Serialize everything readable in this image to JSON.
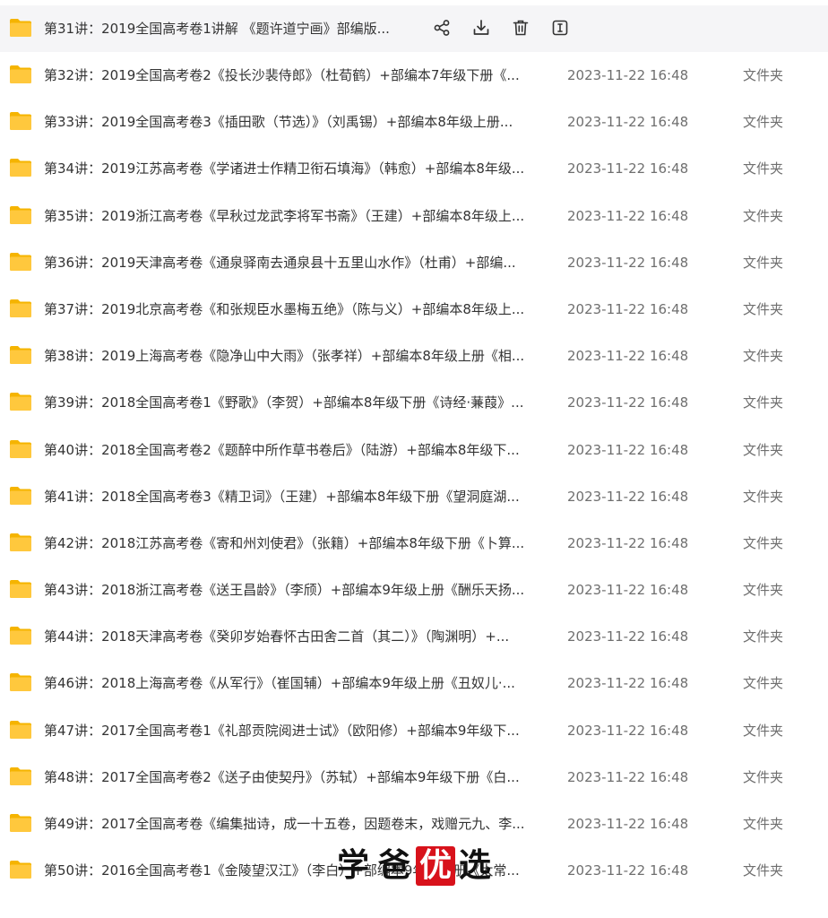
{
  "rows": [
    {
      "name": "第31讲：2019全国高考卷1讲解 《题许道宁画》部编版...",
      "date": "",
      "type": "",
      "hover": true
    },
    {
      "name": "第32讲：2019全国高考卷2《投长沙裴侍郎》（杜荀鹤）+部编本7年级下册《...",
      "date": "2023-11-22 16:48",
      "type": "文件夹"
    },
    {
      "name": "第33讲：2019全国高考卷3《插田歌（节选）》（刘禹锡）+部编本8年级上册...",
      "date": "2023-11-22 16:48",
      "type": "文件夹"
    },
    {
      "name": "第34讲：2019江苏高考卷《学诸进士作精卫衔石填海》（韩愈）+部编本8年级...",
      "date": "2023-11-22 16:48",
      "type": "文件夹"
    },
    {
      "name": "第35讲：2019浙江高考卷《早秋过龙武李将军书斋》（王建）+部编本8年级上...",
      "date": "2023-11-22 16:48",
      "type": "文件夹"
    },
    {
      "name": "第36讲：2019天津高考卷《通泉驿南去通泉县十五里山水作》（杜甫）+部编...",
      "date": "2023-11-22 16:48",
      "type": "文件夹"
    },
    {
      "name": "第37讲：2019北京高考卷《和张规臣水墨梅五绝》（陈与义）+部编本8年级上...",
      "date": "2023-11-22 16:48",
      "type": "文件夹"
    },
    {
      "name": "第38讲：2019上海高考卷《隐净山中大雨》（张孝祥）+部编本8年级上册《相...",
      "date": "2023-11-22 16:48",
      "type": "文件夹"
    },
    {
      "name": "第39讲：2018全国高考卷1《野歌》（李贺）+部编本8年级下册《诗经·蒹葭》...",
      "date": "2023-11-22 16:48",
      "type": "文件夹"
    },
    {
      "name": "第40讲：2018全国高考卷2《题醉中所作草书卷后》（陆游）+部编本8年级下...",
      "date": "2023-11-22 16:48",
      "type": "文件夹"
    },
    {
      "name": "第41讲：2018全国高考卷3《精卫词》（王建）+部编本8年级下册《望洞庭湖...",
      "date": "2023-11-22 16:48",
      "type": "文件夹"
    },
    {
      "name": "第42讲：2018江苏高考卷《寄和州刘使君》（张籍）+部编本8年级下册《卜算...",
      "date": "2023-11-22 16:48",
      "type": "文件夹"
    },
    {
      "name": "第43讲：2018浙江高考卷《送王昌龄》（李颀）+部编本9年级上册《酬乐天扬...",
      "date": "2023-11-22 16:48",
      "type": "文件夹"
    },
    {
      "name": "第44讲：2018天津高考卷《癸卯岁始春怀古田舍二首（其二）》（陶渊明）+...",
      "date": "2023-11-22 16:48",
      "type": "文件夹"
    },
    {
      "name": "第46讲：2018上海高考卷《从军行》（崔国辅）+部编本9年级上册《丑奴儿·...",
      "date": "2023-11-22 16:48",
      "type": "文件夹"
    },
    {
      "name": "第47讲：2017全国高考卷1《礼部贡院阅进士试》（欧阳修）+部编本9年级下...",
      "date": "2023-11-22 16:48",
      "type": "文件夹"
    },
    {
      "name": "第48讲：2017全国高考卷2《送子由使契丹》（苏轼）+部编本9年级下册《白...",
      "date": "2023-11-22 16:48",
      "type": "文件夹"
    },
    {
      "name": "第49讲：2017全国高考卷《编集拙诗，成一十五卷，因题卷末，戏赠元九、李...",
      "date": "2023-11-22 16:48",
      "type": "文件夹"
    },
    {
      "name": "第50讲：2016全国高考卷1《金陵望汉江》（李白）+部编本9年级下册《太常...",
      "date": "2023-11-22 16:48",
      "type": "文件夹"
    }
  ],
  "hover_actions": [
    "share-icon",
    "download-icon",
    "delete-icon",
    "rename-icon"
  ],
  "watermark": {
    "chars": [
      "学",
      "爸",
      "优",
      "选"
    ],
    "highlight_color": "#d8121b"
  },
  "colors": {
    "folder": "#ffc83d",
    "folder_tab": "#f5b400",
    "action_icon": "#333333"
  }
}
